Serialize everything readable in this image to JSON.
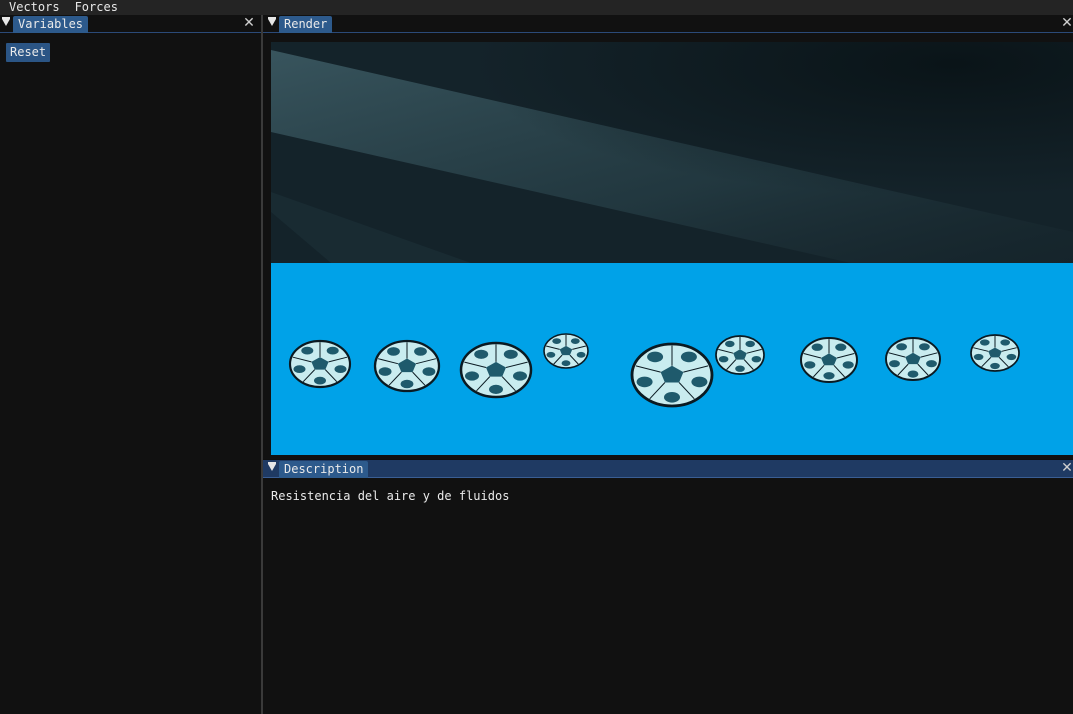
{
  "menubar": {
    "items": [
      "Vectors",
      "Forces"
    ]
  },
  "variables_panel": {
    "tab_label": "Variables",
    "reset_label": "Reset"
  },
  "render_panel": {
    "tab_label": "Render",
    "colors": {
      "sky_dark": "#0e1a20",
      "water": "#00a2e8",
      "ball_dark": "#1f5a6c",
      "ball_light": "#c9ecef",
      "ball_outline": "#0a1a22"
    },
    "balls_icon": "soccer-ball-icon",
    "ball_count": 9
  },
  "description_panel": {
    "tab_label": "Description",
    "text": "Resistencia del aire y de fluidos"
  },
  "theme": {
    "panel_bg": "#111111",
    "tab_active": "#2d5a8c",
    "header_active": "#1f3a63",
    "button": "#2b5585"
  }
}
